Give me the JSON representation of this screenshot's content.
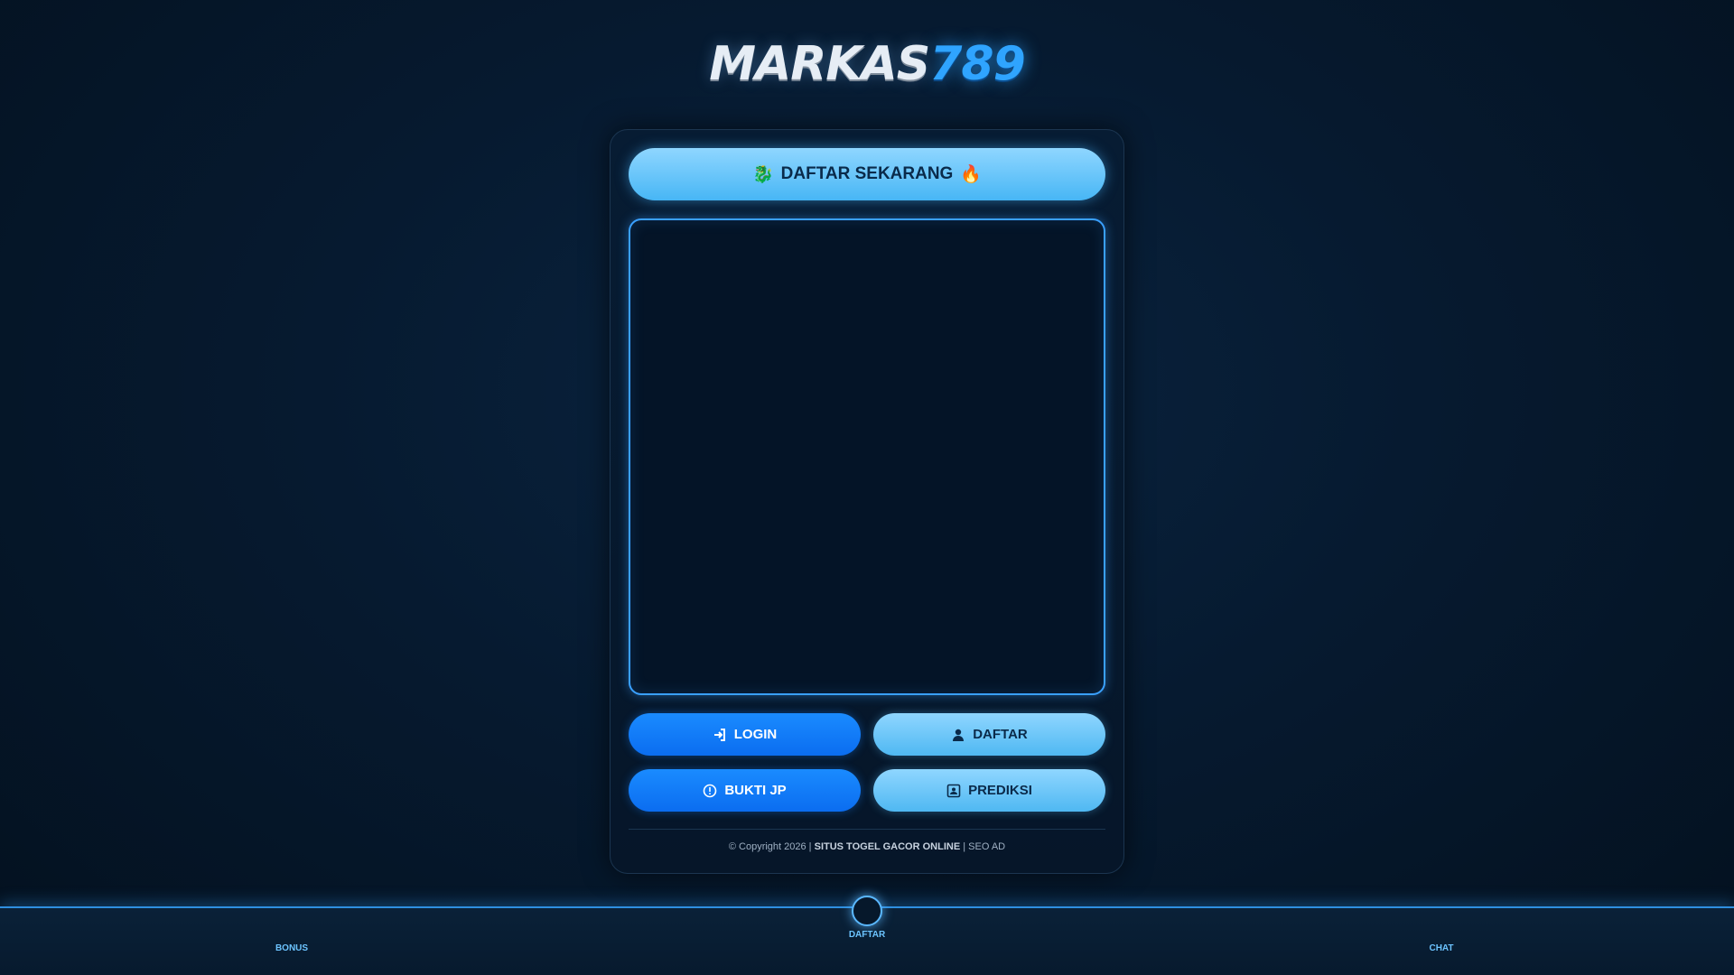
{
  "logo": {
    "part1": "MARKAS",
    "part2": "789"
  },
  "cta": {
    "icon_left": "🐉",
    "label": "DAFTAR SEKARANG",
    "icon_right": "🔥"
  },
  "buttons": [
    {
      "label": "LOGIN",
      "icon": "login-icon"
    },
    {
      "label": "DAFTAR",
      "icon": "user-icon"
    },
    {
      "label": "BUKTI JP",
      "icon": "alert-circle-icon"
    },
    {
      "label": "PREDIKSI",
      "icon": "portrait-box-icon"
    }
  ],
  "footer": {
    "copyright": "© Copyright 2026 |",
    "site": "SITUS TOGEL GACOR ONLINE",
    "separator": "|",
    "seo": "SEO AD"
  },
  "bottom_nav": {
    "left": "BONUS",
    "center": "DAFTAR",
    "right": "CHAT"
  },
  "colors": {
    "accent_blue": "#0b6df0",
    "accent_light": "#8fd6ff",
    "frame_border": "#3aa0ff"
  }
}
